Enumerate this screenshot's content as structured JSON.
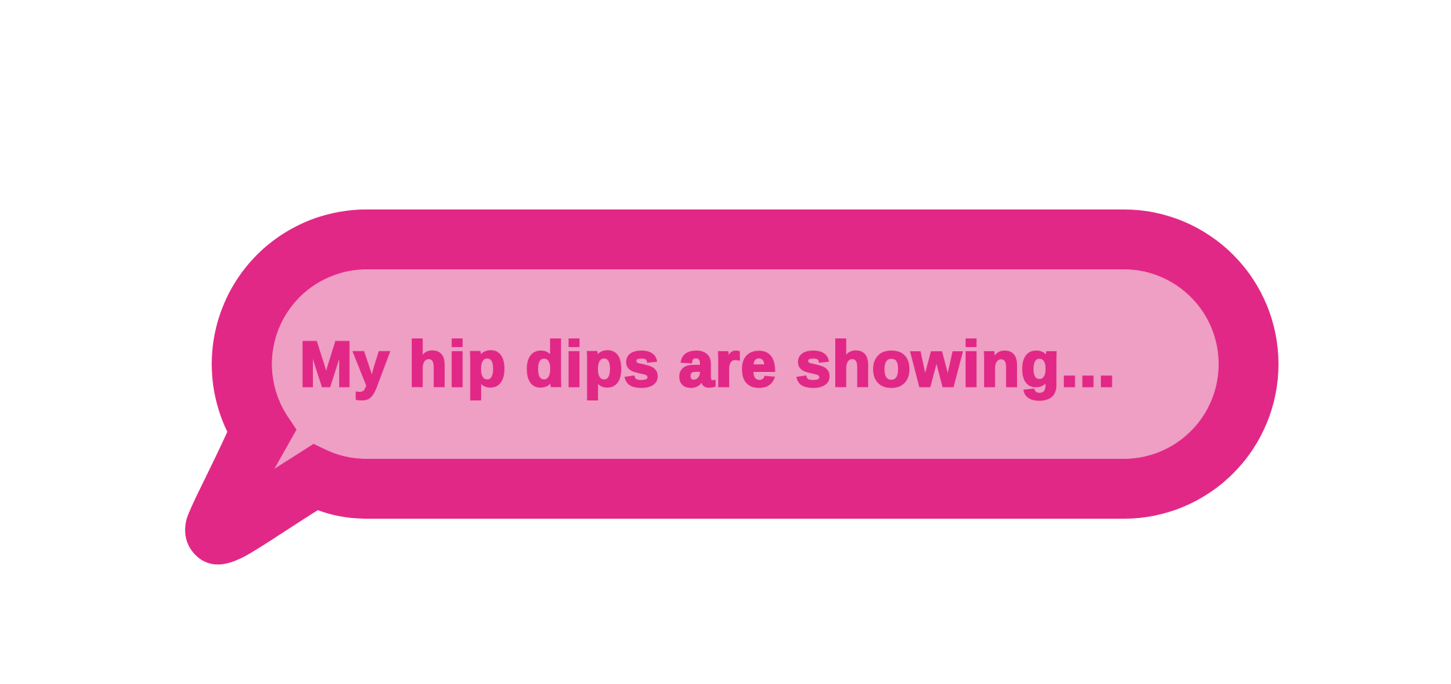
{
  "bubble": {
    "text": "My hip dips are showing...",
    "outline_color": "#E12886",
    "fill_color": "#EF9EC4",
    "text_color": "#E12886"
  }
}
